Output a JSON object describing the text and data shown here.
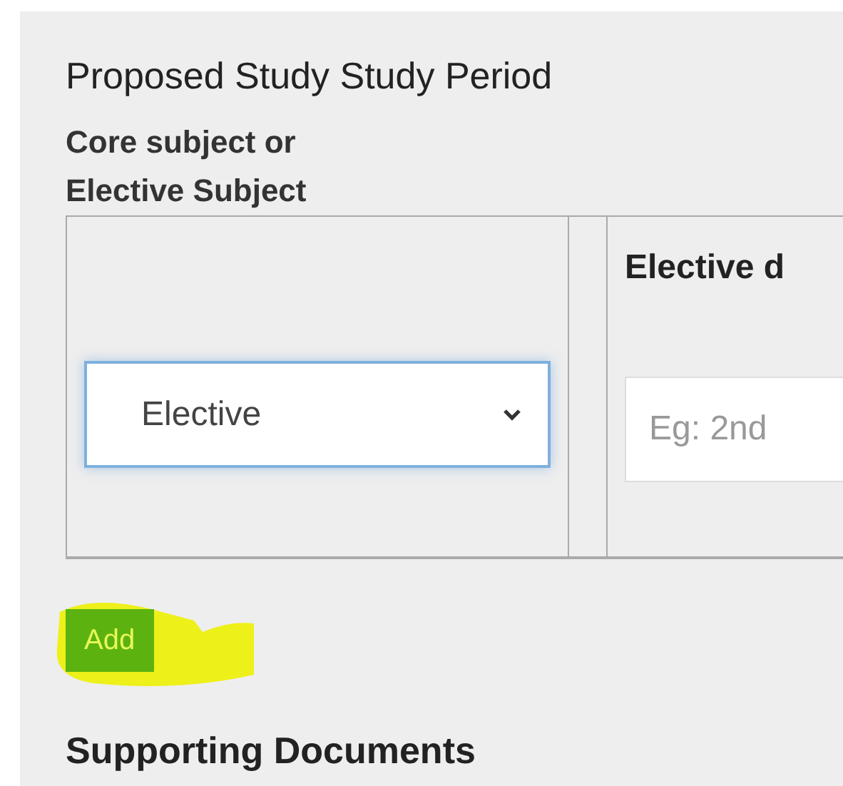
{
  "section_title": "Proposed Study Study Period",
  "field_label": [
    "Core subject or",
    "Elective Subject"
  ],
  "table": {
    "details_header": "Elective d",
    "row": {
      "subject_type": {
        "value": "Elective"
      },
      "details": {
        "placeholder": "Eg: 2nd"
      }
    }
  },
  "add_button": {
    "label": "Add",
    "highlighted": true
  },
  "next_section_title": "Supporting Documents"
}
